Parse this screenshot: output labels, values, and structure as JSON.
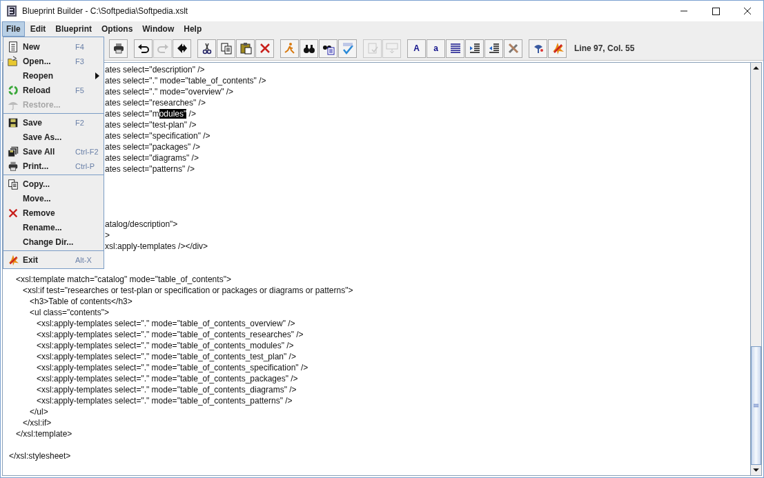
{
  "window": {
    "title": "Blueprint Builder - C:\\Softpedia\\Softpedia.xslt"
  },
  "menubar": [
    {
      "label": "File",
      "selected": true
    },
    {
      "label": "Edit",
      "selected": false
    },
    {
      "label": "Blueprint",
      "selected": false
    },
    {
      "label": "Options",
      "selected": false
    },
    {
      "label": "Window",
      "selected": false
    },
    {
      "label": "Help",
      "selected": false
    }
  ],
  "toolbar": {
    "groups": [
      [
        {
          "kind": "print",
          "disabled": false
        }
      ],
      [
        {
          "kind": "undo",
          "disabled": false
        },
        {
          "kind": "redo",
          "disabled": true
        },
        {
          "kind": "mark",
          "disabled": false
        }
      ],
      [
        {
          "kind": "cut",
          "disabled": false
        },
        {
          "kind": "copy",
          "disabled": false
        },
        {
          "kind": "paste",
          "disabled": false
        },
        {
          "kind": "delete",
          "disabled": false
        }
      ],
      [
        {
          "kind": "run",
          "disabled": false
        },
        {
          "kind": "find",
          "disabled": false
        },
        {
          "kind": "find-files",
          "disabled": false
        },
        {
          "kind": "spell",
          "disabled": false
        }
      ],
      [
        {
          "kind": "validate",
          "disabled": true
        },
        {
          "kind": "transform",
          "disabled": true
        }
      ],
      [
        {
          "kind": "text",
          "label": "A",
          "disabled": false
        },
        {
          "kind": "text",
          "label": "a",
          "disabled": false
        },
        {
          "kind": "align",
          "disabled": false
        },
        {
          "kind": "indent",
          "disabled": false
        },
        {
          "kind": "outdent",
          "disabled": false
        },
        {
          "kind": "tools",
          "disabled": false
        }
      ],
      [
        {
          "kind": "help",
          "disabled": false
        },
        {
          "kind": "exit",
          "disabled": false
        }
      ]
    ],
    "status": "Line 97, Col. 55"
  },
  "file_menu": [
    [
      {
        "kind": "new",
        "label": "New",
        "shortcut": "F4",
        "submenu": false,
        "disabled": false
      },
      {
        "kind": "open",
        "label": "Open...",
        "shortcut": "F3",
        "submenu": false,
        "disabled": false
      },
      {
        "kind": "plain",
        "label": "Reopen",
        "submenu": true,
        "disabled": false
      },
      {
        "kind": "reload",
        "label": "Reload",
        "shortcut": "F5",
        "submenu": false,
        "disabled": false
      },
      {
        "kind": "restore",
        "label": "Restore...",
        "submenu": false,
        "disabled": true
      }
    ],
    [
      {
        "kind": "save",
        "label": "Save",
        "shortcut": "F2",
        "submenu": false,
        "disabled": false
      },
      {
        "kind": "plain",
        "label": "Save As...",
        "submenu": false,
        "disabled": false
      },
      {
        "kind": "saveall",
        "label": "Save All",
        "shortcut": "Ctrl-F2",
        "submenu": false,
        "disabled": false
      },
      {
        "kind": "print",
        "label": "Print...",
        "shortcut": "Ctrl-P",
        "submenu": false,
        "disabled": false
      }
    ],
    [
      {
        "kind": "copy",
        "label": "Copy...",
        "submenu": false,
        "disabled": false
      },
      {
        "kind": "plain",
        "label": "Move...",
        "submenu": false,
        "disabled": false
      },
      {
        "kind": "delete",
        "label": "Remove",
        "submenu": false,
        "disabled": false
      },
      {
        "kind": "plain",
        "label": "Rename...",
        "submenu": false,
        "disabled": false
      },
      {
        "kind": "plain",
        "label": "Change Dir...",
        "submenu": false,
        "disabled": false
      }
    ],
    [
      {
        "kind": "exit",
        "label": "Exit",
        "shortcut": "Alt-X",
        "submenu": false,
        "disabled": false
      }
    ]
  ],
  "editor": {
    "lines": [
      {
        "kind": "partial",
        "text": "ates select=\"description\" />"
      },
      {
        "kind": "partial",
        "text": "ates select=\".\" mode=\"table_of_contents\" />"
      },
      {
        "kind": "partial",
        "text": "ates select=\".\" mode=\"overview\" />"
      },
      {
        "kind": "partial",
        "text": "ates select=\"researches\" />"
      },
      {
        "kind": "partial",
        "segments": [
          {
            "text": "ates select=\"m",
            "selected": false
          },
          {
            "text": "odules\"",
            "selected": true
          },
          {
            "text": " />",
            "selected": false
          }
        ]
      },
      {
        "kind": "partial",
        "text": "ates select=\"test-plan\" />"
      },
      {
        "kind": "partial",
        "text": "ates select=\"specification\" />"
      },
      {
        "kind": "partial",
        "text": "ates select=\"packages\" />"
      },
      {
        "kind": "partial",
        "text": "ates select=\"diagrams\" />"
      },
      {
        "kind": "partial",
        "text": "ates select=\"patterns\" />"
      },
      {
        "kind": "blank"
      },
      {
        "kind": "blank"
      },
      {
        "kind": "blank"
      },
      {
        "kind": "blank"
      },
      {
        "kind": "partial",
        "text": "atalog/description\">"
      },
      {
        "kind": "partial",
        "text": ">"
      },
      {
        "kind": "partial",
        "text": "xsl:apply-templates /></div>"
      },
      {
        "kind": "blank"
      },
      {
        "kind": "blank"
      },
      {
        "kind": "full",
        "text": "   <xsl:template match=\"catalog\" mode=\"table_of_contents\">"
      },
      {
        "kind": "full",
        "text": "      <xsl:if test=\"researches or test-plan or specification or packages or diagrams or patterns\">"
      },
      {
        "kind": "full",
        "text": "         <h3>Table of contents</h3>"
      },
      {
        "kind": "full",
        "text": "         <ul class=\"contents\">"
      },
      {
        "kind": "full",
        "text": "            <xsl:apply-templates select=\".\" mode=\"table_of_contents_overview\" />"
      },
      {
        "kind": "full",
        "text": "            <xsl:apply-templates select=\".\" mode=\"table_of_contents_researches\" />"
      },
      {
        "kind": "full",
        "text": "            <xsl:apply-templates select=\".\" mode=\"table_of_contents_modules\" />"
      },
      {
        "kind": "full",
        "text": "            <xsl:apply-templates select=\".\" mode=\"table_of_contents_test_plan\" />"
      },
      {
        "kind": "full",
        "text": "            <xsl:apply-templates select=\".\" mode=\"table_of_contents_specification\" />"
      },
      {
        "kind": "full",
        "text": "            <xsl:apply-templates select=\".\" mode=\"table_of_contents_packages\" />"
      },
      {
        "kind": "full",
        "text": "            <xsl:apply-templates select=\".\" mode=\"table_of_contents_diagrams\" />"
      },
      {
        "kind": "full",
        "text": "            <xsl:apply-templates select=\".\" mode=\"table_of_contents_patterns\" />"
      },
      {
        "kind": "full",
        "text": "         </ul>"
      },
      {
        "kind": "full",
        "text": "      </xsl:if>"
      },
      {
        "kind": "full",
        "text": "   </xsl:template>"
      },
      {
        "kind": "blank"
      },
      {
        "kind": "full",
        "text": "</xsl:stylesheet>"
      }
    ]
  }
}
